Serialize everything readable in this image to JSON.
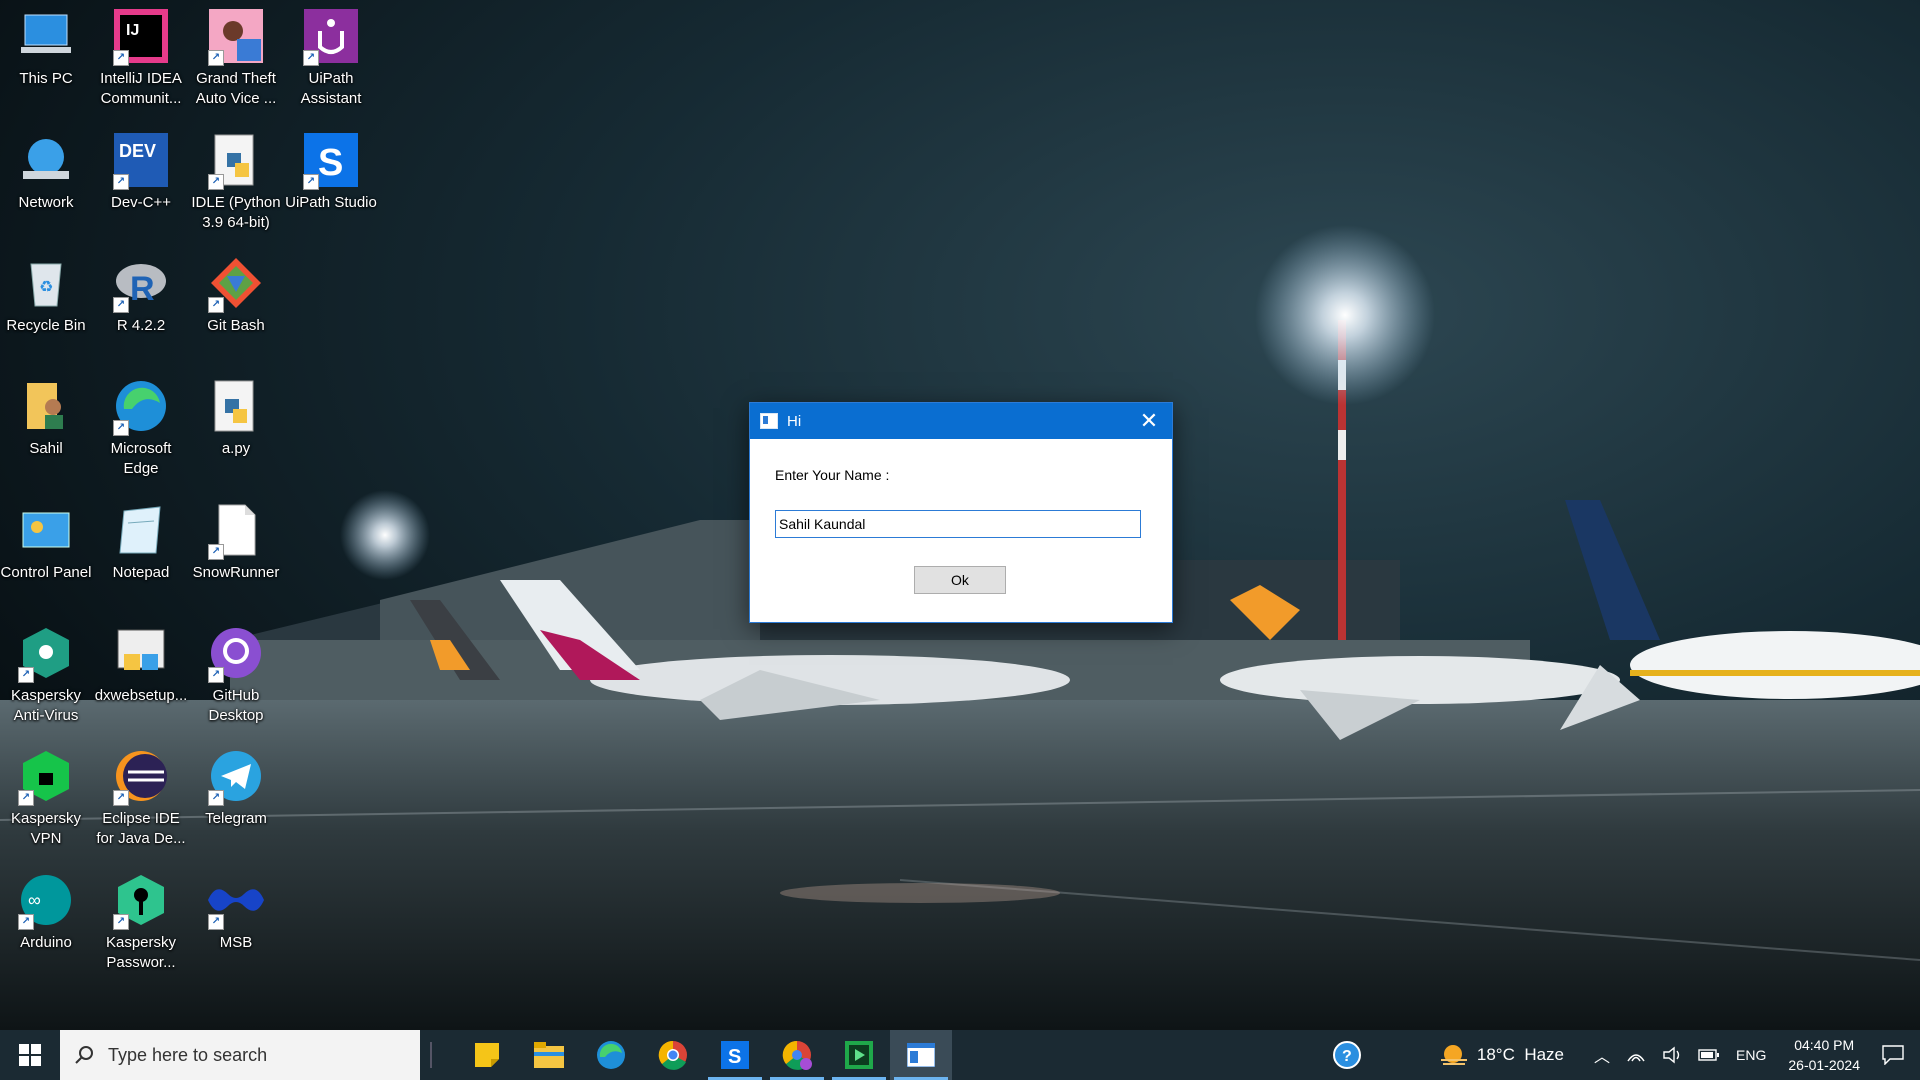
{
  "desktop": {
    "icons": [
      {
        "label": "This PC"
      },
      {
        "label": "IntelliJ IDEA Communit..."
      },
      {
        "label": "Grand Theft Auto Vice ..."
      },
      {
        "label": "UiPath Assistant"
      },
      {
        "label": "Network"
      },
      {
        "label": "Dev-C++"
      },
      {
        "label": "IDLE (Python 3.9 64-bit)"
      },
      {
        "label": "UiPath Studio"
      },
      {
        "label": "Recycle Bin"
      },
      {
        "label": "R 4.2.2"
      },
      {
        "label": "Git Bash"
      },
      {
        "label": "Sahil"
      },
      {
        "label": "Microsoft Edge"
      },
      {
        "label": "a.py"
      },
      {
        "label": "Control Panel"
      },
      {
        "label": "Notepad"
      },
      {
        "label": "SnowRunner"
      },
      {
        "label": "Kaspersky Anti-Virus"
      },
      {
        "label": "dxwebsetup..."
      },
      {
        "label": "GitHub Desktop"
      },
      {
        "label": "Kaspersky VPN"
      },
      {
        "label": "Eclipse IDE for Java De..."
      },
      {
        "label": "Telegram"
      },
      {
        "label": "Arduino"
      },
      {
        "label": "Kaspersky Passwor..."
      },
      {
        "label": "MSB"
      }
    ]
  },
  "dialog": {
    "title": "Hi",
    "close_glyph": "✕",
    "prompt": "Enter Your Name :",
    "input_value": "Sahil Kaundal",
    "ok_label": "Ok"
  },
  "taskbar": {
    "search_placeholder": "Type here to search",
    "weather": "18°C  Haze",
    "language": "ENG",
    "time": "04:40 PM",
    "date": "26-01-2024",
    "apps": [
      "sticky-notes",
      "file-explorer",
      "edge",
      "chrome",
      "uipath-studio",
      "chrome-profile",
      "camtasia",
      "dialog-window"
    ]
  },
  "colors": {
    "titlebar": "#0a6ed1",
    "taskbar": "#1b2a33",
    "accent": "#2c7bd6"
  }
}
